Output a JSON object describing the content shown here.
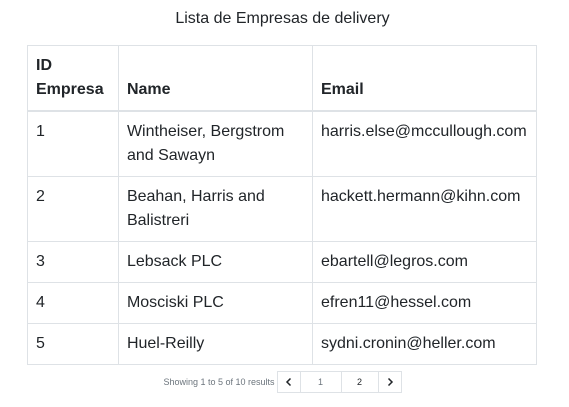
{
  "caption": "Lista de Empresas de delivery",
  "table": {
    "headers": {
      "id": "ID Empresa",
      "name": "Name",
      "email": "Email"
    },
    "rows": [
      {
        "id": "1",
        "name": "Wintheiser, Bergstrom and Sawayn",
        "email": "harris.else@mccullough.com"
      },
      {
        "id": "2",
        "name": "Beahan, Harris and Balistreri",
        "email": "hackett.hermann@kihn.com"
      },
      {
        "id": "3",
        "name": "Lebsack PLC",
        "email": "ebartell@legros.com"
      },
      {
        "id": "4",
        "name": "Mosciski PLC",
        "email": "efren11@hessel.com"
      },
      {
        "id": "5",
        "name": "Huel-Reilly",
        "email": "sydni.cronin@heller.com"
      }
    ]
  },
  "pagination": {
    "results_text": "Showing 1 to 5 of 10 results",
    "prev_icon": "chevron-left-icon",
    "next_icon": "chevron-right-icon",
    "pages": [
      "1",
      "2"
    ],
    "current_page": "1"
  }
}
